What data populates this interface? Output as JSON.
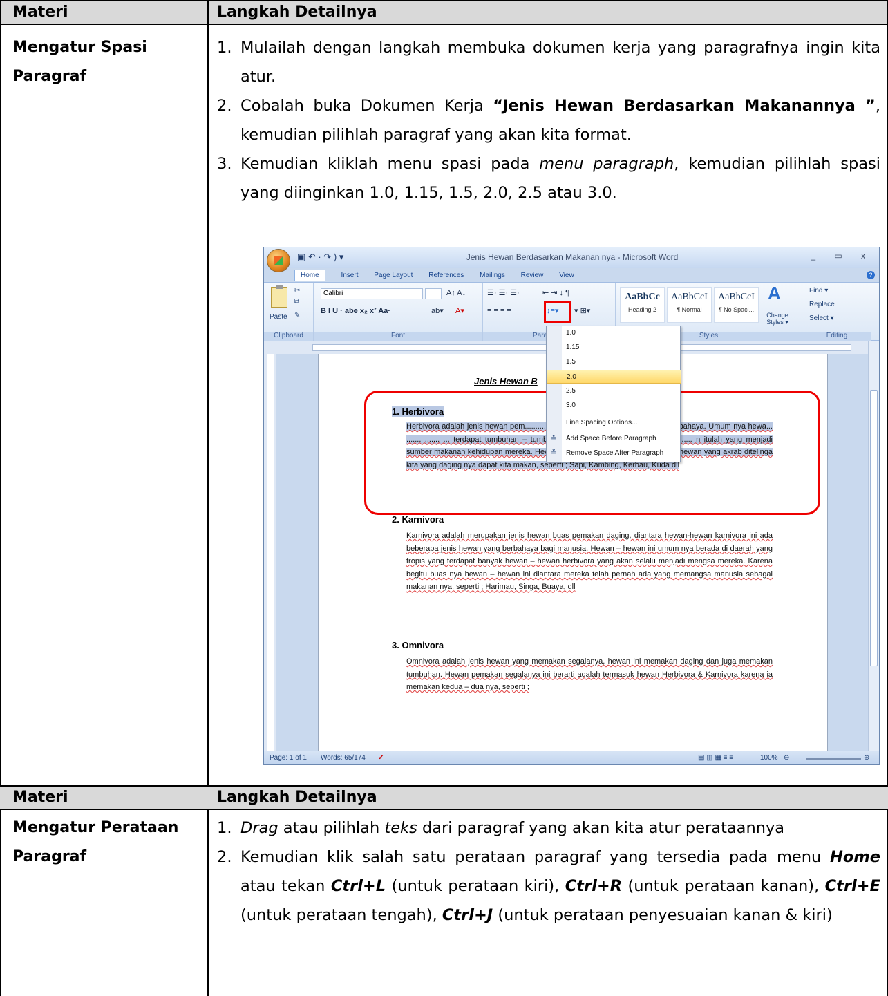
{
  "table1": {
    "header_col1": "Materi",
    "header_col2": "Langkah Detailnya",
    "topic_line1": "Mengatur Spasi",
    "topic_line2": "Paragraf",
    "steps": [
      {
        "num": "1.",
        "text": "Mulailah dengan langkah membuka dokumen kerja yang paragrafnya ingin kita atur."
      },
      {
        "num": "2.",
        "pre": "Cobalah buka Dokumen Kerja ",
        "bold": "“Jenis Hewan Berdasarkan Makanannya ”",
        "post": ", kemudian pilihlah paragraf yang akan kita format."
      },
      {
        "num": "3.",
        "pre": "Kemudian kliklah menu spasi pada ",
        "italic": "menu paragraph",
        "post": ", kemudian pilihlah spasi yang diinginkan 1.0, 1.15, 1.5, 2.0, 2.5 atau 3.0."
      }
    ]
  },
  "word": {
    "window_title": "Jenis Hewan Berdasarkan Makanan nya - Microsoft Word",
    "qat": "▣ ↶ · ↷ ) ▾",
    "window_buttons": "_ ▭ x",
    "tabs": [
      "Home",
      "Insert",
      "Page Layout",
      "References",
      "Mailings",
      "Review",
      "View"
    ],
    "help": "?",
    "groups": {
      "clipboard": "Clipboard",
      "font": "Font",
      "paragraph": "Paragr",
      "styles": "Styles",
      "editing": "Editing"
    },
    "paste_label": "Paste",
    "font_name": "Calibri",
    "font_tools": "B  I  U · abe x₂ x² Aa·",
    "styles": [
      {
        "preview": "AaBbCc",
        "name": "Heading 2"
      },
      {
        "preview": "AaBbCcI",
        "name": "¶ Normal"
      },
      {
        "preview": "AaBbCcI",
        "name": "¶ No Spaci..."
      }
    ],
    "change_styles": "Change Styles ▾",
    "editing_items": [
      "Find ▾",
      "Replace",
      "Select ▾"
    ],
    "spacing_menu": {
      "options": [
        "1.0",
        "1.15",
        "1.5",
        "2.0",
        "2.5",
        "3.0"
      ],
      "selected": "2.0",
      "line_spacing_options": "Line Spacing Options...",
      "add_before": "Add Space Before Paragraph",
      "remove_after": "Remove Space After Paragraph"
    },
    "doc_title": "Jenis Hewan B",
    "sections": [
      {
        "head": "1.  Herbivora",
        "body": "Herbivora adalah jenis hewan pem.......... ....... ...unya bukanlah hewan yang berbahaya. Umum nya hewa... ....... ....... ... terdapat tumbuhan – tumbuhan hijau tumbuh di atasnya... ....... ..... n itulah yang menjadi sumber makanan kehidupan mereka. Hewan Herbivora ini biasanya merupakan hewan yang akrab ditelinga kita yang daging nya dapat kita makan, seperti ; Sapi, Kambing, Kerbau, Kuda dll"
      },
      {
        "head": "2.  Karnivora",
        "body": "Karnivora adalah merupakan jenis hewan buas pemakan daging, diantara hewan-hewan karnivora ini ada beberapa jenis hewan yang berbahaya bagi manusia. Hewan – hewan ini umum nya berada di daerah yang tropis yang terdapat banyak hewan – hewan herbivora yang akan selalu menjadi mengsa mereka. Karena begitu buas nya hewan – hewan ini diantara mereka telah pernah ada yang memangsa manusia sebagai makanan nya, seperti ; Harimau, Singa, Buaya, dll"
      },
      {
        "head": "3.  Omnivora",
        "body": "Omnivora adalah jenis hewan yang memakan segalanya, hewan ini memakan daging dan juga memakan tumbuhan. Hewan pemakan segalanya ini berarti adalah termasuk hewan Herbivora & Karnivora karena ia memakan kedua – dua nya, seperti ;"
      }
    ],
    "status_page": "Page: 1 of 1",
    "status_words": "Words: 65/174",
    "zoom": "100%"
  },
  "table2": {
    "header_col1": "Materi",
    "header_col2": "Langkah Detailnya",
    "topic_line1": "Mengatur Perataan",
    "topic_line2": "Paragraf",
    "step1": {
      "num": "1.",
      "i1": "Drag",
      "t1": " atau pilihlah ",
      "i2": "teks",
      "t2": " dari paragraf yang akan kita atur perataannya"
    },
    "step2": {
      "num": "2.",
      "t1": "Kemudian klik salah satu perataan paragraf yang tersedia pada menu ",
      "b1": "Home",
      "t2": " atau tekan ",
      "b2": "Ctrl+L",
      "t3": " (untuk perataan kiri), ",
      "b3": "Ctrl+R",
      "t4": " (untuk perataan kanan), ",
      "b4": "Ctrl+E",
      "t5": " (untuk perataan tengah), ",
      "b5": "Ctrl+J",
      "t6": " (untuk perataan penyesuaian kanan & kiri)"
    }
  }
}
